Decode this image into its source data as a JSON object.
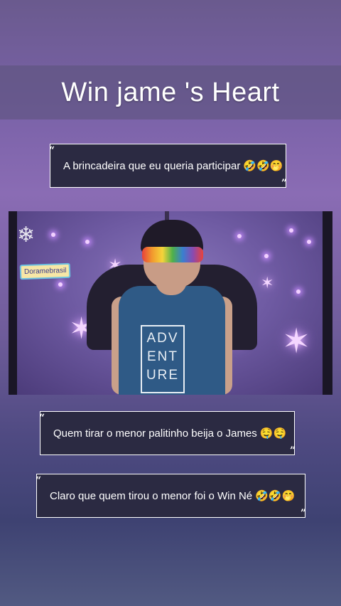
{
  "title": "Win jame 's Heart",
  "captions": [
    {
      "text": "A brincadeira que eu queria participar",
      "emoji": "🤣🤣🤭"
    },
    {
      "text": "Quem tirar o menor palitinho beija o James",
      "emoji": "🤤🤤"
    },
    {
      "text": "Claro que quem tirou o menor foi o Win Né",
      "emoji": "🤣🤣🤭"
    }
  ],
  "quotes": {
    "open": "“",
    "close": "”"
  },
  "video": {
    "watermark_label": "Doramebrasil",
    "watermark_icon": "snowflake-icon",
    "shirt_text": [
      "ADV",
      "ENT",
      "URE"
    ]
  },
  "colors": {
    "caption_bg": "#2b2a42",
    "caption_border": "#ffffff",
    "title_text": "#ffffff"
  }
}
